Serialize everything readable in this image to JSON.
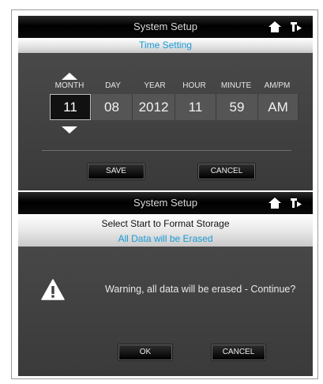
{
  "panel_time": {
    "title": "System Setup",
    "subtitle": "Time Setting",
    "columns": [
      {
        "label": "MONTH",
        "value": "11"
      },
      {
        "label": "DAY",
        "value": "08"
      },
      {
        "label": "YEAR",
        "value": "2012"
      },
      {
        "label": "HOUR",
        "value": "11"
      },
      {
        "label": "MINUTE",
        "value": "59"
      },
      {
        "label": "AM/PM",
        "value": "AM"
      }
    ],
    "save_label": "SAVE",
    "cancel_label": "CANCEL"
  },
  "panel_format": {
    "title": "System Setup",
    "line1": "Select Start to Format Storage",
    "line2": "All Data will be Erased",
    "warning": "Warning, all data will be erased - Continue?",
    "ok_label": "OK",
    "cancel_label": "CANCEL"
  },
  "icons": {
    "home": "home-icon",
    "back": "back-icon",
    "warning": "warning-icon"
  },
  "colors": {
    "accent": "#1a9bd7",
    "panel_bg": "#444444",
    "titlebar_bg": "#000000"
  }
}
